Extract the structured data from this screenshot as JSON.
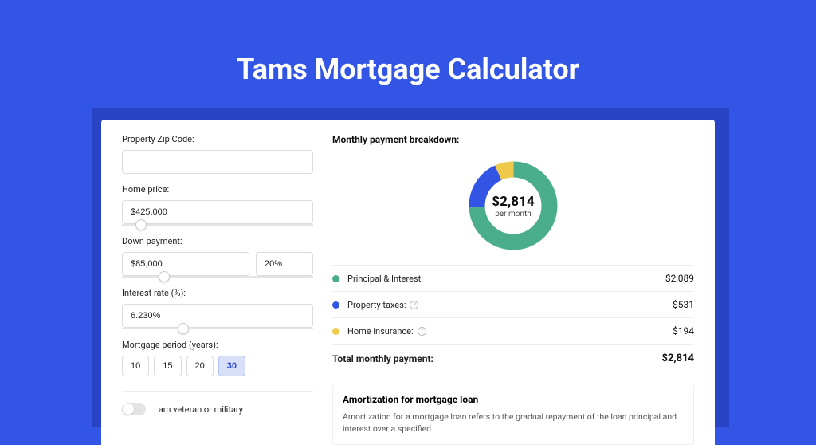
{
  "pageTitle": "Tams Mortgage Calculator",
  "form": {
    "zipLabel": "Property Zip Code:",
    "zipValue": "",
    "homePriceLabel": "Home price:",
    "homePriceValue": "$425,000",
    "homePriceSliderPct": 7,
    "downPaymentLabel": "Down payment:",
    "downPaymentValue": "$85,000",
    "downPaymentPct": "20%",
    "downPaymentSliderPct": 19,
    "interestLabel": "Interest rate (%):",
    "interestValue": "6.230%",
    "interestSliderPct": 29,
    "periodLabel": "Mortgage period (years):",
    "periods": [
      "10",
      "15",
      "20",
      "30"
    ],
    "periodSelected": "30",
    "veteranLabel": "I am veteran or military"
  },
  "breakdown": {
    "title": "Monthly payment breakdown:",
    "donutAmount": "$2,814",
    "donutSub": "per month",
    "rows": [
      {
        "label": "Principal & Interest:",
        "value": "$2,089",
        "color": "#4aae8c",
        "info": false
      },
      {
        "label": "Property taxes:",
        "value": "$531",
        "color": "#3355e5",
        "info": true
      },
      {
        "label": "Home insurance:",
        "value": "$194",
        "color": "#efc94c",
        "info": true
      }
    ],
    "totalLabel": "Total monthly payment:",
    "totalValue": "$2,814"
  },
  "chart_data": {
    "type": "pie",
    "title": "Monthly payment breakdown",
    "series": [
      {
        "name": "Principal & Interest",
        "value": 2089,
        "color": "#4aae8c"
      },
      {
        "name": "Property taxes",
        "value": 531,
        "color": "#3355e5"
      },
      {
        "name": "Home insurance",
        "value": 194,
        "color": "#efc94c"
      }
    ],
    "total": 2814,
    "unit": "USD per month"
  },
  "amortization": {
    "title": "Amortization for mortgage loan",
    "text": "Amortization for a mortgage loan refers to the gradual repayment of the loan principal and interest over a specified"
  }
}
